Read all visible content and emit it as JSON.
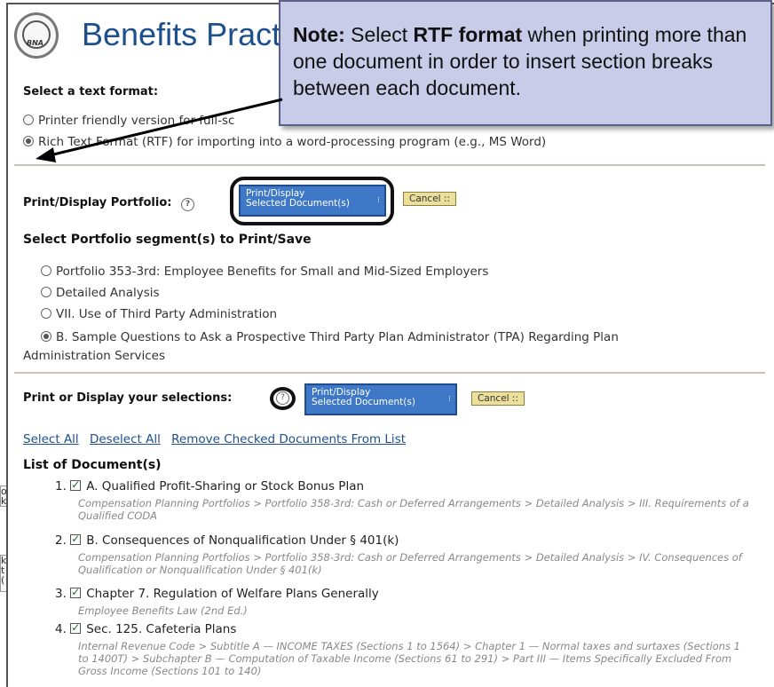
{
  "header": {
    "title": "Benefits Pract",
    "logo_text": "BNA"
  },
  "note": {
    "prefix": "Note:",
    "text_1": " Select ",
    "emphasis": "RTF format",
    "text_2": " when printing more than one document in order to insert section breaks between each document."
  },
  "format": {
    "label": "Select a text format:",
    "options": [
      {
        "label": "Printer friendly version for full-sc",
        "selected": false
      },
      {
        "label": "Rich Text Format (RTF) for importing into a word-processing program (e.g., MS Word)",
        "selected": true
      }
    ]
  },
  "print_portfolio": {
    "label": "Print/Display Portfolio:",
    "button_line1": "Print/Display",
    "button_line2": "Selected Document(s)",
    "cancel": "Cancel ::"
  },
  "segments": {
    "label": "Select Portfolio segment(s) to Print/Save",
    "items": [
      {
        "label": "Portfolio 353-3rd: Employee Benefits for Small and Mid-Sized Employers",
        "selected": false
      },
      {
        "label": "Detailed Analysis",
        "selected": false
      },
      {
        "label": "VII. Use of Third Party Administration",
        "selected": false
      },
      {
        "label": "B. Sample Questions to Ask a Prospective Third Party Plan Administrator (TPA) Regarding Plan",
        "label_cont": "Administration Services",
        "selected": true
      }
    ]
  },
  "print_selections": {
    "label": "Print or Display your selections:",
    "button_line1": "Print/Display",
    "button_line2": "Selected Document(s)",
    "cancel": "Cancel ::"
  },
  "links": {
    "select_all": "Select All",
    "deselect_all": "Deselect All",
    "remove": "Remove Checked Documents From List"
  },
  "documents": {
    "label": "List of Document(s)",
    "items": [
      {
        "num": "1.",
        "title": "A. Qualified Profit-Sharing or Stock Bonus Plan",
        "path": "Compensation Planning Portfolios > Portfolio 358-3rd: Cash or Deferred Arrangements > Detailed Analysis > III. Requirements of a Qualified CODA"
      },
      {
        "num": "2.",
        "title": "B. Consequences of Nonqualification Under § 401(k)",
        "path": "Compensation Planning Portfolios > Portfolio 358-3rd: Cash or Deferred Arrangements > Detailed Analysis > IV. Consequences of Qualification or Nonqualification Under § 401(k)"
      },
      {
        "num": "3.",
        "title": "Chapter 7. Regulation of Welfare Plans Generally",
        "path": "Employee Benefits Law (2nd Ed.)"
      },
      {
        "num": "4.",
        "title": "Sec. 125. Cafeteria Plans",
        "path": "Internal Revenue Code > Subtitle A — INCOME TAXES (Sections 1 to 1564) > Chapter 1 — Normal taxes and surtaxes (Sections 1 to 1400T) > Subchapter B — Computation of Taxable Income (Sections 61 to 291) > Part III — Items Specifically Excluded From Gross Income (Sections 101 to 140)"
      }
    ]
  },
  "bg_fragments": [
    "o",
    "k",
    "k",
    "t",
    "("
  ],
  "colors": {
    "note_bg": "#c8cce9",
    "title_blue": "#1c4f8c",
    "button_blue": "#3e78c6",
    "cancel_bg": "#ecdf9c"
  }
}
